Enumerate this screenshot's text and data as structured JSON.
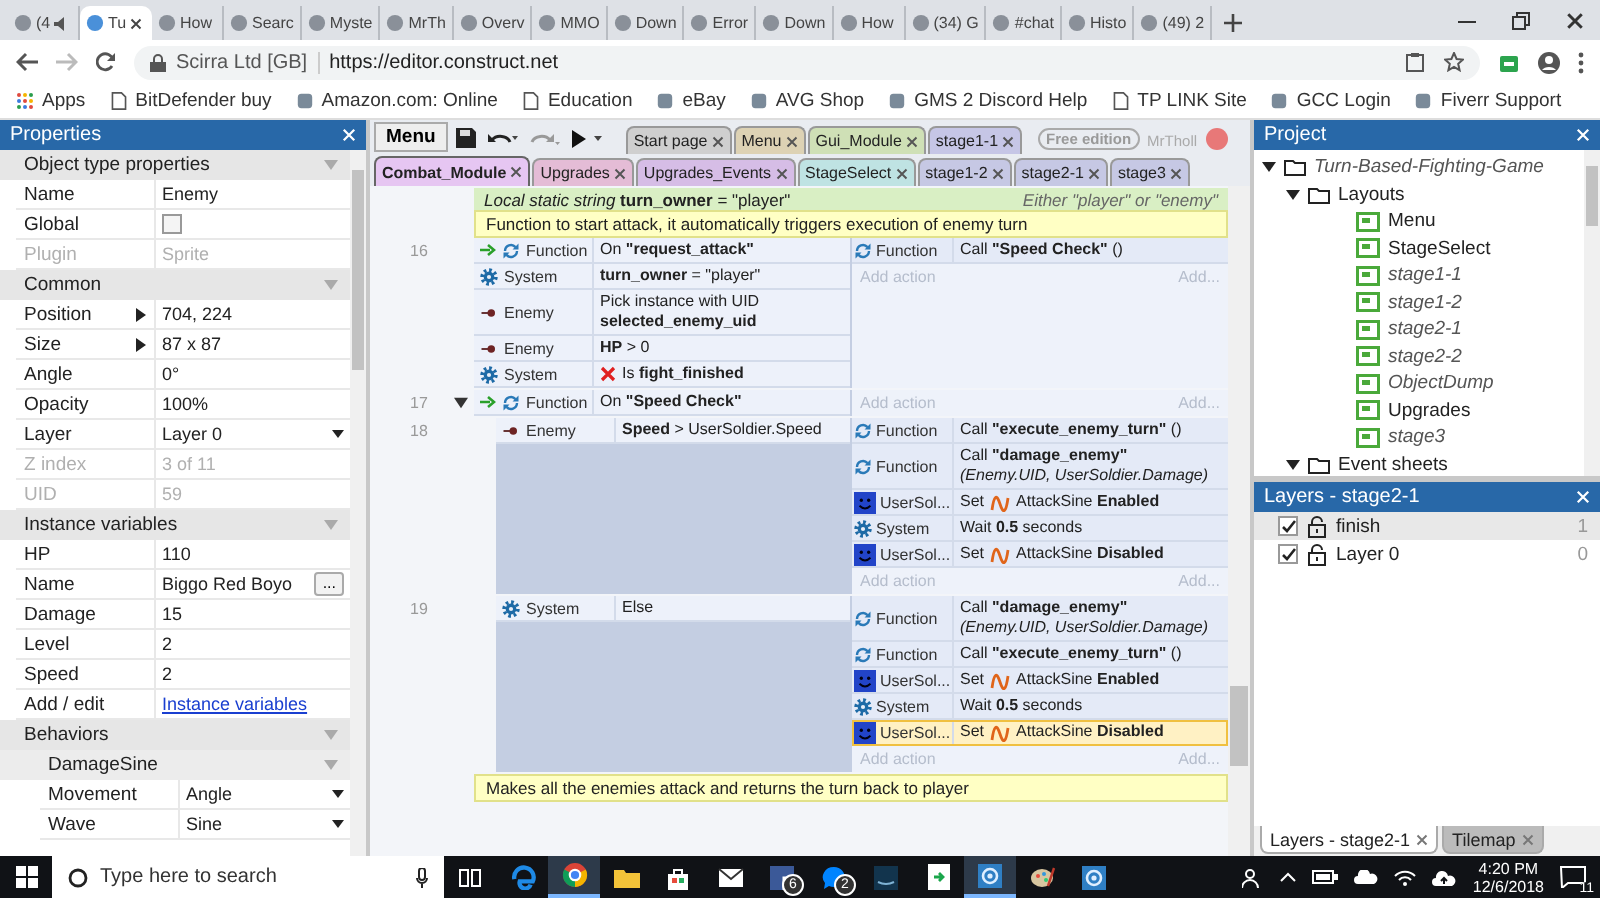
{
  "browser": {
    "tabs": [
      {
        "title": "(4",
        "selected": false,
        "audio": true
      },
      {
        "title": "Tu",
        "selected": true,
        "audio": false
      },
      {
        "title": "How",
        "selected": false,
        "audio": false
      },
      {
        "title": "Searc",
        "selected": false,
        "audio": false
      },
      {
        "title": "Myste",
        "selected": false,
        "audio": false
      },
      {
        "title": "MrTh",
        "selected": false,
        "audio": false
      },
      {
        "title": "Overv",
        "selected": false,
        "audio": false
      },
      {
        "title": "MMO",
        "selected": false,
        "audio": false
      },
      {
        "title": "Down",
        "selected": false,
        "audio": false
      },
      {
        "title": "Error",
        "selected": false,
        "audio": false
      },
      {
        "title": "Down",
        "selected": false,
        "audio": false
      },
      {
        "title": "How",
        "selected": false,
        "audio": false
      },
      {
        "title": "(34) G",
        "selected": false,
        "audio": false
      },
      {
        "title": "#chat",
        "selected": false,
        "audio": false
      },
      {
        "title": "Histo",
        "selected": false,
        "audio": false
      },
      {
        "title": "(49) 2",
        "selected": false,
        "audio": false
      }
    ],
    "site": "Scirra Ltd [GB]",
    "url": "https://editor.construct.net",
    "bookmarks": [
      {
        "label": "Apps",
        "kind": "apps"
      },
      {
        "label": "BitDefender buy",
        "kind": "page"
      },
      {
        "label": "Amazon.com: Online",
        "kind": "site"
      },
      {
        "label": "Education",
        "kind": "page"
      },
      {
        "label": "eBay",
        "kind": "site"
      },
      {
        "label": "AVG Shop",
        "kind": "site"
      },
      {
        "label": "GMS 2 Discord Help",
        "kind": "site"
      },
      {
        "label": "TP LINK Site",
        "kind": "page"
      },
      {
        "label": "GCC Login",
        "kind": "site"
      },
      {
        "label": "Fiverr Support",
        "kind": "site"
      }
    ]
  },
  "properties": {
    "title": "Properties",
    "sections": [
      {
        "title": "Object type properties",
        "rows": [
          {
            "kind": "text",
            "label": "Name",
            "value": "Enemy",
            "disabled": false
          },
          {
            "kind": "checkbox",
            "label": "Global",
            "checked": false,
            "disabled": false
          },
          {
            "kind": "text",
            "label": "Plugin",
            "value": "Sprite",
            "disabled": true
          }
        ]
      },
      {
        "title": "Common",
        "rows": [
          {
            "kind": "expander",
            "label": "Position",
            "value": "704, 224",
            "disabled": false
          },
          {
            "kind": "expander",
            "label": "Size",
            "value": "87 x 87",
            "disabled": false
          },
          {
            "kind": "text",
            "label": "Angle",
            "value": "0°",
            "disabled": false
          },
          {
            "kind": "text",
            "label": "Opacity",
            "value": "100%",
            "disabled": false
          },
          {
            "kind": "dropdown",
            "label": "Layer",
            "value": "Layer 0",
            "disabled": false
          },
          {
            "kind": "text",
            "label": "Z index",
            "value": "3 of 11",
            "disabled": true
          },
          {
            "kind": "text",
            "label": "UID",
            "value": "59",
            "disabled": true
          }
        ]
      },
      {
        "title": "Instance variables",
        "rows": [
          {
            "kind": "text",
            "label": "HP",
            "value": "110",
            "disabled": false
          },
          {
            "kind": "button",
            "label": "Name",
            "value": "Biggo Red Boyo",
            "button": "...",
            "disabled": false
          },
          {
            "kind": "text",
            "label": "Damage",
            "value": "15",
            "disabled": false
          },
          {
            "kind": "text",
            "label": "Level",
            "value": "2",
            "disabled": false
          },
          {
            "kind": "text",
            "label": "Speed",
            "value": "2",
            "disabled": false
          },
          {
            "kind": "link",
            "label": "Add / edit",
            "value": "Instance variables",
            "disabled": false
          }
        ]
      },
      {
        "title": "Behaviors",
        "subsections": [
          {
            "title": "DamageSine",
            "rows": [
              {
                "kind": "dropdown",
                "label": "Movement",
                "value": "Angle",
                "disabled": false
              },
              {
                "kind": "dropdown",
                "label": "Wave",
                "value": "Sine",
                "disabled": false
              }
            ]
          }
        ]
      }
    ]
  },
  "editor": {
    "menu_button": "Menu",
    "edition": "Free edition",
    "user": "MrTholl",
    "tabs_row_1": [
      {
        "label": "Start page",
        "color": "#cfcfcf",
        "selected": false
      },
      {
        "label": "Menu",
        "color": "#ddd2b4",
        "selected": false
      },
      {
        "label": "Gui_Module",
        "color": "#cfe0b6",
        "selected": false
      },
      {
        "label": "stage1-1",
        "color": "#c6c6e6",
        "selected": false
      }
    ],
    "tabs_row_2": [
      {
        "label": "Combat_Module",
        "color": "#e6c6f2",
        "selected": true
      },
      {
        "label": "Upgrades",
        "color": "#e4bcd6",
        "selected": false
      },
      {
        "label": "Upgrades_Events",
        "color": "#d6bde6",
        "selected": false
      },
      {
        "label": "StageSelect",
        "color": "#bfe3e3",
        "selected": false
      },
      {
        "label": "stage1-2",
        "color": "#c6c8e4",
        "selected": false
      },
      {
        "label": "stage2-1",
        "color": "#c6c8e4",
        "selected": false
      },
      {
        "label": "stage3",
        "color": "#c6c8e4",
        "selected": false
      }
    ],
    "sheet": [
      {
        "kind": "variable",
        "text": "*Local static string* **turn_owner** = \"player\"",
        "comment": "Either \"player\" or \"enemy\""
      },
      {
        "kind": "comment",
        "text": "Function to start attack, it automatically triggers execution of enemy turn"
      },
      {
        "kind": "event",
        "number": "16",
        "trigger": true,
        "conditions": [
          {
            "object": "Function",
            "kind": "function",
            "text": "On **\"request_attack\"**",
            "inverted": false
          },
          {
            "object": "System",
            "kind": "system",
            "text": "**turn_owner** = \"player\"",
            "inverted": false
          },
          {
            "object": "Enemy",
            "kind": "sprite",
            "text": "Pick instance with UID **selected_enemy_uid**",
            "inverted": false
          },
          {
            "object": "Enemy",
            "kind": "sprite",
            "text": "**HP** > 0",
            "inverted": false
          },
          {
            "object": "System",
            "kind": "system",
            "text": "Is **fight_finished**",
            "inverted": true
          }
        ],
        "actions": [
          {
            "object": "Function",
            "kind": "function",
            "text": "Call **\"Speed Check\"** ()",
            "selected": false
          }
        ],
        "add_action": "Add action",
        "add_more": "Add..."
      },
      {
        "kind": "event",
        "number": "17",
        "trigger": true,
        "expanded": true,
        "conditions": [
          {
            "object": "Function",
            "kind": "function",
            "text": "On **\"Speed Check\"**",
            "inverted": false
          }
        ],
        "add_action": "Add action",
        "add_more": "Add...",
        "children": [
          {
            "kind": "event",
            "number": "18",
            "trigger": false,
            "conditions": [
              {
                "object": "Enemy",
                "kind": "sprite",
                "text": "**Speed** > UserSoldier.Speed",
                "inverted": false
              }
            ],
            "actions": [
              {
                "object": "Function",
                "kind": "function",
                "text": "Call **\"execute_enemy_turn\"** ()",
                "selected": false
              },
              {
                "object": "Function",
                "kind": "function",
                "text": "Call **\"damage_enemy\"** *(Enemy.UID, UserSoldier.Damage)*",
                "selected": false
              },
              {
                "object": "UserSol...",
                "kind": "soldier",
                "text": "Set",
                "behavior": "AttackSine **Enabled**",
                "selected": false
              },
              {
                "object": "System",
                "kind": "system",
                "text": "Wait **0.5** seconds",
                "selected": false
              },
              {
                "object": "UserSol...",
                "kind": "soldier",
                "text": "Set",
                "behavior": "AttackSine **Disabled**",
                "selected": false
              }
            ],
            "add_action": "Add action",
            "add_more": "Add..."
          },
          {
            "kind": "event",
            "number": "19",
            "trigger": false,
            "conditions": [
              {
                "object": "System",
                "kind": "system",
                "text": "Else",
                "inverted": false
              }
            ],
            "actions": [
              {
                "object": "Function",
                "kind": "function",
                "text": "Call **\"damage_enemy\"** *(Enemy.UID, UserSoldier.Damage)*",
                "selected": false
              },
              {
                "object": "Function",
                "kind": "function",
                "text": "Call **\"execute_enemy_turn\"** ()",
                "selected": false
              },
              {
                "object": "UserSol...",
                "kind": "soldier",
                "text": "Set",
                "behavior": "AttackSine **Enabled**",
                "selected": false
              },
              {
                "object": "System",
                "kind": "system",
                "text": "Wait **0.5** seconds",
                "selected": false
              },
              {
                "object": "UserSol...",
                "kind": "soldier",
                "text": "Set",
                "behavior": "AttackSine **Disabled**",
                "selected": true
              }
            ],
            "add_action": "Add action",
            "add_more": "Add..."
          }
        ]
      },
      {
        "kind": "comment",
        "text": "Makes all the enemies attack and returns the turn back to player"
      }
    ]
  },
  "project": {
    "title": "Project",
    "tree": [
      {
        "label": "Turn-Based-Fighting-Game",
        "kind": "folder",
        "italic": true,
        "expanded": true,
        "children": [
          {
            "label": "Layouts",
            "kind": "folder",
            "italic": false,
            "expanded": true,
            "children": [
              {
                "label": "Menu",
                "kind": "layout",
                "italic": false
              },
              {
                "label": "StageSelect",
                "kind": "layout",
                "italic": false
              },
              {
                "label": "stage1-1",
                "kind": "layout",
                "italic": true
              },
              {
                "label": "stage1-2",
                "kind": "layout",
                "italic": true
              },
              {
                "label": "stage2-1",
                "kind": "layout",
                "italic": true
              },
              {
                "label": "stage2-2",
                "kind": "layout",
                "italic": true
              },
              {
                "label": "ObjectDump",
                "kind": "layout",
                "italic": true
              },
              {
                "label": "Upgrades",
                "kind": "layout",
                "italic": false
              },
              {
                "label": "stage3",
                "kind": "layout",
                "italic": true
              }
            ]
          },
          {
            "label": "Event sheets",
            "kind": "folder",
            "italic": false,
            "expanded": true
          }
        ]
      }
    ]
  },
  "layers": {
    "title": "Layers - stage2-1",
    "items": [
      {
        "name": "finish",
        "visible": true,
        "count": "1",
        "selected": true
      },
      {
        "name": "Layer 0",
        "visible": true,
        "count": "0",
        "selected": false
      }
    ],
    "bottom_tabs": [
      {
        "label": "Layers - stage2-1",
        "selected": true
      },
      {
        "label": "Tilemap",
        "selected": false
      }
    ]
  },
  "taskbar": {
    "search_placeholder": "Type here to search",
    "apps": [
      {
        "kind": "taskview",
        "selected": false
      },
      {
        "kind": "edge",
        "selected": false
      },
      {
        "kind": "chrome",
        "selected": true
      },
      {
        "kind": "files",
        "selected": false
      },
      {
        "kind": "store",
        "selected": false
      },
      {
        "kind": "mail",
        "selected": false
      },
      {
        "kind": "facebook",
        "selected": false,
        "badge": "6"
      },
      {
        "kind": "messenger",
        "selected": false,
        "badge": "2"
      },
      {
        "kind": "kindle",
        "selected": false
      },
      {
        "kind": "doc",
        "selected": false
      },
      {
        "kind": "construct",
        "selected": true
      },
      {
        "kind": "paint",
        "selected": false
      },
      {
        "kind": "construct",
        "selected": false
      }
    ],
    "time": "4:20 PM",
    "date": "12/6/2018",
    "notifications": "11"
  }
}
